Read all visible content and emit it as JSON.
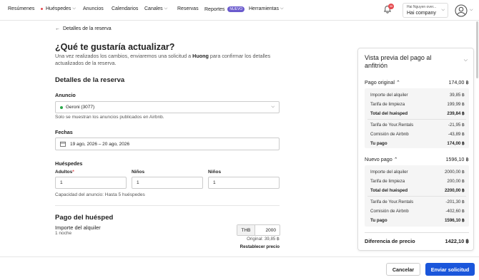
{
  "nav": {
    "items": [
      {
        "label": "Resúmenes"
      },
      {
        "label": "Huéspedes"
      },
      {
        "label": "Anuncios"
      },
      {
        "label": "Calendarios"
      },
      {
        "label": "Canales"
      },
      {
        "label": "Reservas"
      },
      {
        "label": "Reportes",
        "badge": "NUEVO"
      },
      {
        "label": "Herramientas"
      }
    ],
    "notifications_count": "35",
    "account_user": "Hai Nguyen over...",
    "account_company": "Hai company"
  },
  "back_label": "Detalles de la reserva",
  "title": "¿Qué te gustaría actualizar?",
  "intro": {
    "prefix": "Una vez realizados los cambios, enviaremos una solicitud a ",
    "name": "Huong",
    "suffix": " para confirmar los detalles actualizados de la reserva."
  },
  "details": {
    "heading": "Detalles de la reserva",
    "listing_label": "Anuncio",
    "listing_value": "Geroni (3077)",
    "listing_hint": "Solo se muestran los anuncios publicados en Airbnb.",
    "dates_label": "Fechas",
    "dates_value": "19 ago, 2026 – 20 ago, 2026",
    "guests_label": "Huéspedes",
    "adults_label": "Adultos",
    "adults_required": "*",
    "adults_value": "1",
    "children_label": "Niños",
    "children_value": "1",
    "infants_label": "Niños",
    "infants_value": "1",
    "capacity": "Capacidad del anuncio: Hasta 5 huéspedes"
  },
  "payment": {
    "heading": "Pago del huésped",
    "rent_label": "Importe del alquiler",
    "rent_nights": "1 noche",
    "currency": "THB",
    "amount": "2000",
    "original": "Original: 39,85 ฿",
    "reset": "Restablecer precio"
  },
  "preview": {
    "title": "Vista previa del pago al anfitrión",
    "original": {
      "label": "Pago original",
      "total": "174,00 ฿",
      "rows": [
        {
          "label": "Importe del alquiler",
          "value": "39,85 ฿"
        },
        {
          "label": "Tarifa de limpieza",
          "value": "199,99 ฿"
        },
        {
          "label": "Total del huésped",
          "value": "239,84 ฿"
        },
        {
          "label": "Tarifa de Your.Rentals",
          "value": "-21,95 ฿"
        },
        {
          "label": "Comisión de Airbnb",
          "value": "-43,89 ฿"
        },
        {
          "label": "Tu pago",
          "value": "174,00 ฿"
        }
      ]
    },
    "new": {
      "label": "Nuevo pago",
      "total": "1596,10 ฿",
      "rows": [
        {
          "label": "Importe del alquiler",
          "value": "2000,00 ฿"
        },
        {
          "label": "Tarifa de limpieza",
          "value": "200,00 ฿"
        },
        {
          "label": "Total del huésped",
          "value": "2200,00 ฿"
        },
        {
          "label": "Tarifa de Your.Rentals",
          "value": "-201,30 ฿"
        },
        {
          "label": "Comisión de Airbnb",
          "value": "-402,60 ฿"
        },
        {
          "label": "Tu pago",
          "value": "1596,10 ฿"
        }
      ]
    },
    "difference_label": "Diferencia de precio",
    "difference_value": "1422,10 ฿"
  },
  "footer": {
    "cancel": "Cancelar",
    "send": "Enviar solicitud"
  },
  "colors": {
    "primary": "#1a56db",
    "badge": "#6a5acd",
    "alert": "#e5484d",
    "status_green": "#2aa84a"
  }
}
